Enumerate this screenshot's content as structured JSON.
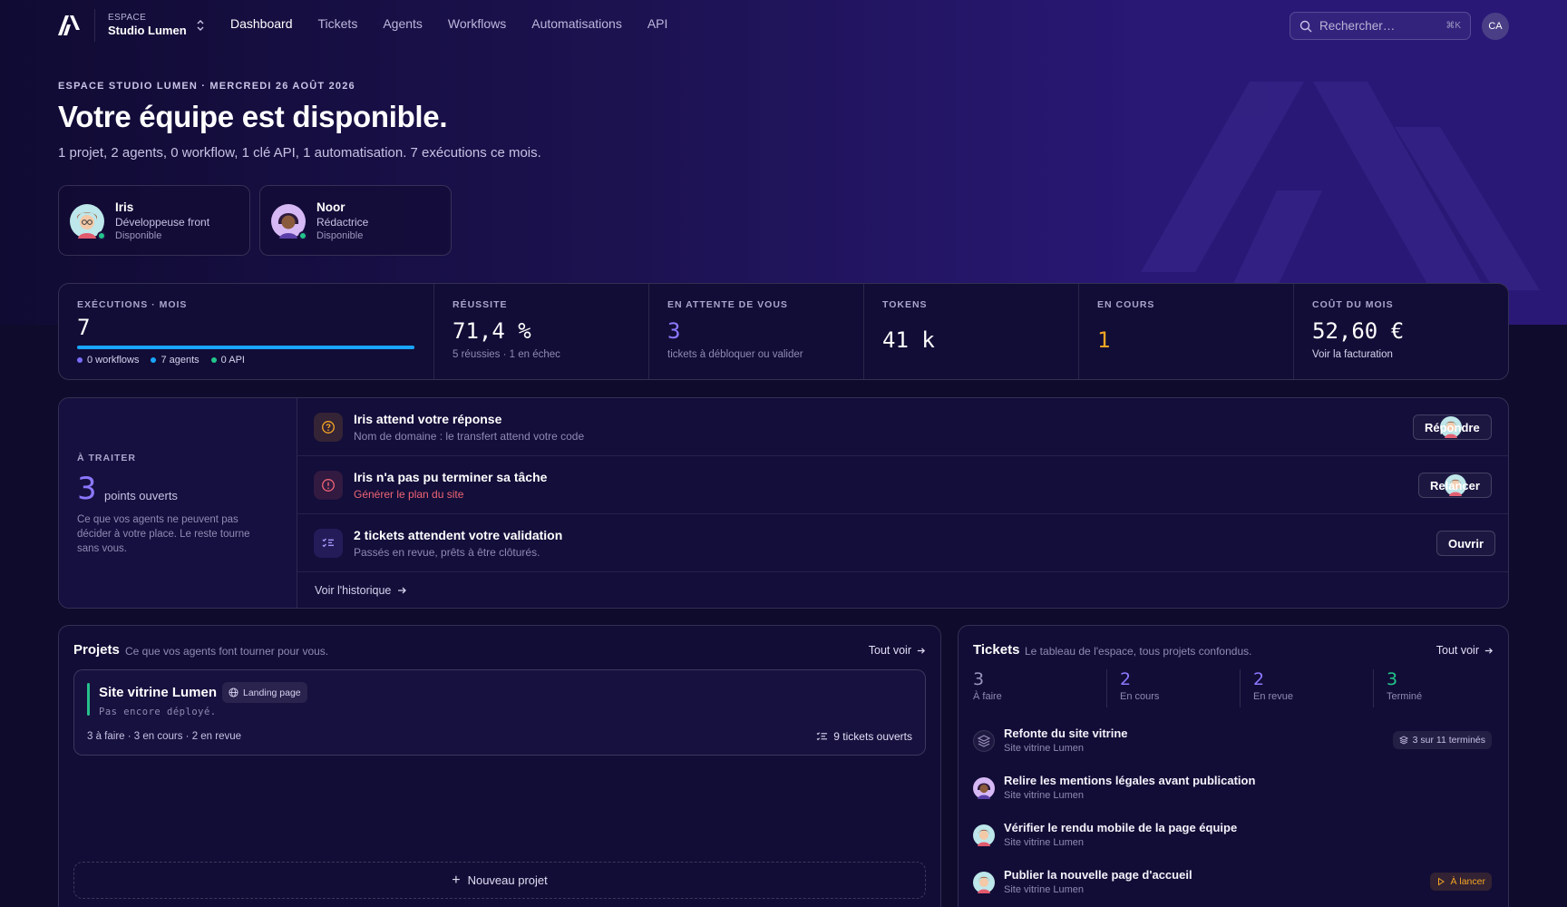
{
  "nav": {
    "workspace_label": "ESPACE",
    "workspace_name": "Studio Lumen",
    "links": [
      {
        "label": "Dashboard",
        "active": true
      },
      {
        "label": "Tickets",
        "active": false
      },
      {
        "label": "Agents",
        "active": false
      },
      {
        "label": "Workflows",
        "active": false
      },
      {
        "label": "Automatisations",
        "active": false
      },
      {
        "label": "API",
        "active": false
      }
    ],
    "search_placeholder": "Rechercher…",
    "search_shortcut": "⌘K",
    "user_initials": "CA"
  },
  "hero": {
    "eyebrow": "ESPACE STUDIO LUMEN · MERCREDI 26 AOÛT 2026",
    "title": "Votre équipe est disponible.",
    "subtitle": "1 projet, 2 agents, 0 workflow, 1 clé API, 1 automatisation. 7 exécutions ce mois."
  },
  "agents": [
    {
      "name": "Iris",
      "role": "Développeuse front",
      "status": "Disponible"
    },
    {
      "name": "Noor",
      "role": "Rédactrice",
      "status": "Disponible"
    }
  ],
  "stats": {
    "executions": {
      "label": "EXÉCUTIONS · MOIS",
      "value": "7",
      "progress": 1.0,
      "legend": [
        {
          "label": "0 workflows",
          "color": "#7b6cff"
        },
        {
          "label": "7 agents",
          "color": "#1aa5ff"
        },
        {
          "label": "0 API",
          "color": "#22c58b"
        }
      ]
    },
    "success": {
      "label": "RÉUSSITE",
      "value": "71,4 %",
      "hint": "5 réussies · 1 en échec"
    },
    "waiting": {
      "label": "EN ATTENTE DE VOUS",
      "value": "3",
      "hint": "tickets à débloquer ou valider",
      "color": "#8b78ff"
    },
    "tokens": {
      "label": "TOKENS",
      "value": "41 k"
    },
    "in_progress": {
      "label": "EN COURS",
      "value": "1",
      "color": "#f5a524"
    },
    "cost": {
      "label": "COÛT DU MOIS",
      "value": "52,60 €",
      "hint": "Voir la facturation"
    }
  },
  "todo": {
    "label": "À TRAITER",
    "count": "3",
    "count_label": "points ouverts",
    "description": "Ce que vos agents ne peuvent pas décider à votre place. Le reste tourne sans vous.",
    "items": [
      {
        "title": "Iris attend votre réponse",
        "subtitle": "Nom de domaine : le transfert attend votre code",
        "action": "Répondre",
        "icon": "question-icon"
      },
      {
        "title": "Iris n'a pas pu terminer sa tâche",
        "subtitle": "Générer le plan du site",
        "action": "Relancer",
        "icon": "alert-icon"
      },
      {
        "title": "2 tickets attendent votre validation",
        "subtitle": "Passés en revue, prêts à être clôturés.",
        "action": "Ouvrir",
        "icon": "checklist-icon"
      }
    ],
    "history_label": "Voir l'historique"
  },
  "projects": {
    "title": "Projets",
    "subtitle": "Ce que vos agents font tourner pour vous.",
    "see_all": "Tout voir",
    "items": [
      {
        "name": "Site vitrine Lumen",
        "tag": "Landing page",
        "deploy": "Pas encore déployé.",
        "counts": "3 à faire · 3 en cours · 2 en revue",
        "open_tickets": "9 tickets ouverts"
      }
    ],
    "new_label": "Nouveau projet"
  },
  "tickets": {
    "title": "Tickets",
    "subtitle": "Le tableau de l'espace, tous projets confondus.",
    "see_all": "Tout voir",
    "stats": [
      {
        "value": "3",
        "label": "À faire",
        "color": "#9a95bd"
      },
      {
        "value": "2",
        "label": "En cours",
        "color": "#8b78ff"
      },
      {
        "value": "2",
        "label": "En revue",
        "color": "#8b78ff"
      },
      {
        "value": "3",
        "label": "Terminé",
        "color": "#22c58b"
      }
    ],
    "items": [
      {
        "title": "Refonte du site vitrine",
        "project": "Site vitrine Lumen",
        "badge": "3 sur 11 terminés"
      },
      {
        "title": "Relire les mentions légales avant publication",
        "project": "Site vitrine Lumen",
        "badge": ""
      },
      {
        "title": "Vérifier le rendu mobile de la page équipe",
        "project": "Site vitrine Lumen",
        "badge": ""
      },
      {
        "title": "Publier la nouvelle page d'accueil",
        "project": "Site vitrine Lumen",
        "badge": "À lancer"
      }
    ]
  }
}
